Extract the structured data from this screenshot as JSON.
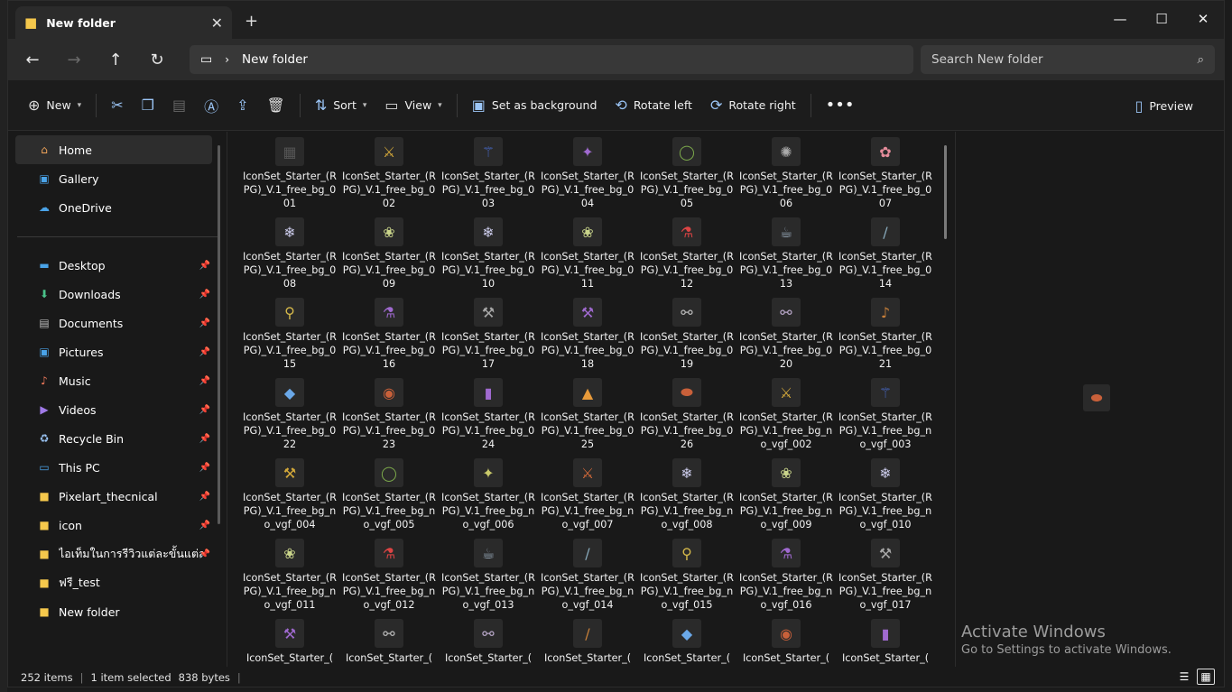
{
  "tab": {
    "title": "New folder"
  },
  "address": {
    "segment": "New folder"
  },
  "search": {
    "placeholder": "Search New folder"
  },
  "toolbar": {
    "new": "New",
    "sort": "Sort",
    "view": "View",
    "set_bg": "Set as background",
    "rotate_left": "Rotate left",
    "rotate_right": "Rotate right",
    "preview": "Preview"
  },
  "sidebar": {
    "top": [
      {
        "label": "Home",
        "icon": "home-icon",
        "selected": true
      },
      {
        "label": "Gallery",
        "icon": "gallery-icon"
      },
      {
        "label": "OneDrive",
        "icon": "cloud-icon"
      }
    ],
    "pinned": [
      {
        "label": "Desktop",
        "icon": "desktop-icon"
      },
      {
        "label": "Downloads",
        "icon": "download-icon"
      },
      {
        "label": "Documents",
        "icon": "document-icon"
      },
      {
        "label": "Pictures",
        "icon": "picture-icon"
      },
      {
        "label": "Music",
        "icon": "music-icon"
      },
      {
        "label": "Videos",
        "icon": "video-icon"
      },
      {
        "label": "Recycle Bin",
        "icon": "recycle-bin-icon"
      },
      {
        "label": "This PC",
        "icon": "pc-icon"
      },
      {
        "label": "Pixelart_thecnical",
        "icon": "folder-icon"
      },
      {
        "label": "icon",
        "icon": "folder-icon"
      },
      {
        "label": "ไอเท็มในการรีวิวแต่ละขั้นแต่ละขนาด",
        "icon": "folder-icon"
      },
      {
        "label": "ฟรี_test",
        "icon": "folder-icon"
      },
      {
        "label": "New folder",
        "icon": "folder-icon"
      }
    ]
  },
  "files": [
    "IconSet_Starter_(RPG)_V.1_free_bg_001",
    "IconSet_Starter_(RPG)_V.1_free_bg_002",
    "IconSet_Starter_(RPG)_V.1_free_bg_003",
    "IconSet_Starter_(RPG)_V.1_free_bg_004",
    "IconSet_Starter_(RPG)_V.1_free_bg_005",
    "IconSet_Starter_(RPG)_V.1_free_bg_006",
    "IconSet_Starter_(RPG)_V.1_free_bg_007",
    "IconSet_Starter_(RPG)_V.1_free_bg_008",
    "IconSet_Starter_(RPG)_V.1_free_bg_009",
    "IconSet_Starter_(RPG)_V.1_free_bg_010",
    "IconSet_Starter_(RPG)_V.1_free_bg_011",
    "IconSet_Starter_(RPG)_V.1_free_bg_012",
    "IconSet_Starter_(RPG)_V.1_free_bg_013",
    "IconSet_Starter_(RPG)_V.1_free_bg_014",
    "IconSet_Starter_(RPG)_V.1_free_bg_015",
    "IconSet_Starter_(RPG)_V.1_free_bg_016",
    "IconSet_Starter_(RPG)_V.1_free_bg_017",
    "IconSet_Starter_(RPG)_V.1_free_bg_018",
    "IconSet_Starter_(RPG)_V.1_free_bg_019",
    "IconSet_Starter_(RPG)_V.1_free_bg_020",
    "IconSet_Starter_(RPG)_V.1_free_bg_021",
    "IconSet_Starter_(RPG)_V.1_free_bg_022",
    "IconSet_Starter_(RPG)_V.1_free_bg_023",
    "IconSet_Starter_(RPG)_V.1_free_bg_024",
    "IconSet_Starter_(RPG)_V.1_free_bg_025",
    "IconSet_Starter_(RPG)_V.1_free_bg_026",
    "IconSet_Starter_(RPG)_V.1_free_bg_no_vgf_002",
    "IconSet_Starter_(RPG)_V.1_free_bg_no_vgf_003",
    "IconSet_Starter_(RPG)_V.1_free_bg_no_vgf_004",
    "IconSet_Starter_(RPG)_V.1_free_bg_no_vgf_005",
    "IconSet_Starter_(RPG)_V.1_free_bg_no_vgf_006",
    "IconSet_Starter_(RPG)_V.1_free_bg_no_vgf_007",
    "IconSet_Starter_(RPG)_V.1_free_bg_no_vgf_008",
    "IconSet_Starter_(RPG)_V.1_free_bg_no_vgf_009",
    "IconSet_Starter_(RPG)_V.1_free_bg_no_vgf_010",
    "IconSet_Starter_(RPG)_V.1_free_bg_no_vgf_011",
    "IconSet_Starter_(RPG)_V.1_free_bg_no_vgf_012",
    "IconSet_Starter_(RPG)_V.1_free_bg_no_vgf_013",
    "IconSet_Starter_(RPG)_V.1_free_bg_no_vgf_014",
    "IconSet_Starter_(RPG)_V.1_free_bg_no_vgf_015",
    "IconSet_Starter_(RPG)_V.1_free_bg_no_vgf_016",
    "IconSet_Starter_(RPG)_V.1_free_bg_no_vgf_017",
    "IconSet_Starter_(",
    "IconSet_Starter_(",
    "IconSet_Starter_(",
    "IconSet_Starter_(",
    "IconSet_Starter_(",
    "IconSet_Starter_(",
    "IconSet_Starter_("
  ],
  "thumb_glyphs": [
    "▦",
    "⚔",
    "⚚",
    "✦",
    "◯",
    "✺",
    "✿",
    "❄",
    "❀",
    "❄",
    "❀",
    "⚗",
    "☕",
    "/",
    "⚲",
    "⚗",
    "⚒",
    "⚒",
    "⚯",
    "⚯",
    "♪",
    "◆",
    "◉",
    "▮",
    "▲",
    "⬬",
    "⚔",
    "⚚",
    "⚒",
    "◯",
    "✦",
    "⚔",
    "❄",
    "❀",
    "❄",
    "❀",
    "⚗",
    "☕",
    "/",
    "⚲",
    "⚗",
    "⚒",
    "⚒",
    "⚯",
    "⚯",
    "/",
    "◆",
    "◉",
    "▮"
  ],
  "thumb_colors": [
    "#555",
    "#d4a93a",
    "#4a6fd6",
    "#a06ad0",
    "#7aa64a",
    "#aaa",
    "#e58c9a",
    "#c9c9e8",
    "#c9d48a",
    "#c9c9e8",
    "#c9d48a",
    "#d44",
    "#9ab",
    "#8ab",
    "#d4b84a",
    "#a06ad0",
    "#a8a8a8",
    "#a06ad0",
    "#bbb",
    "#b9a8c9",
    "#c8803a",
    "#6aa8e8",
    "#c8603a",
    "#a06ad0",
    "#e89a3a",
    "#c8603a",
    "#d4a93a",
    "#4a6fd6",
    "#d4a93a",
    "#7aa64a",
    "#c9c96a",
    "#d46a3a",
    "#c9c9e8",
    "#c9d48a",
    "#c9c9e8",
    "#c9d48a",
    "#d44",
    "#9ab",
    "#8ab",
    "#d4b84a",
    "#a06ad0",
    "#a8a8a8",
    "#a06ad0",
    "#bbb",
    "#b9a8c9",
    "#c8803a",
    "#6aa8e8",
    "#c8603a",
    "#a06ad0"
  ],
  "preview_glyph": "⬬",
  "activation": {
    "line1": "Activate Windows",
    "line2": "Go to Settings to activate Windows."
  },
  "status": {
    "count": "252 items",
    "selected": "1 item selected",
    "size": "838 bytes"
  }
}
